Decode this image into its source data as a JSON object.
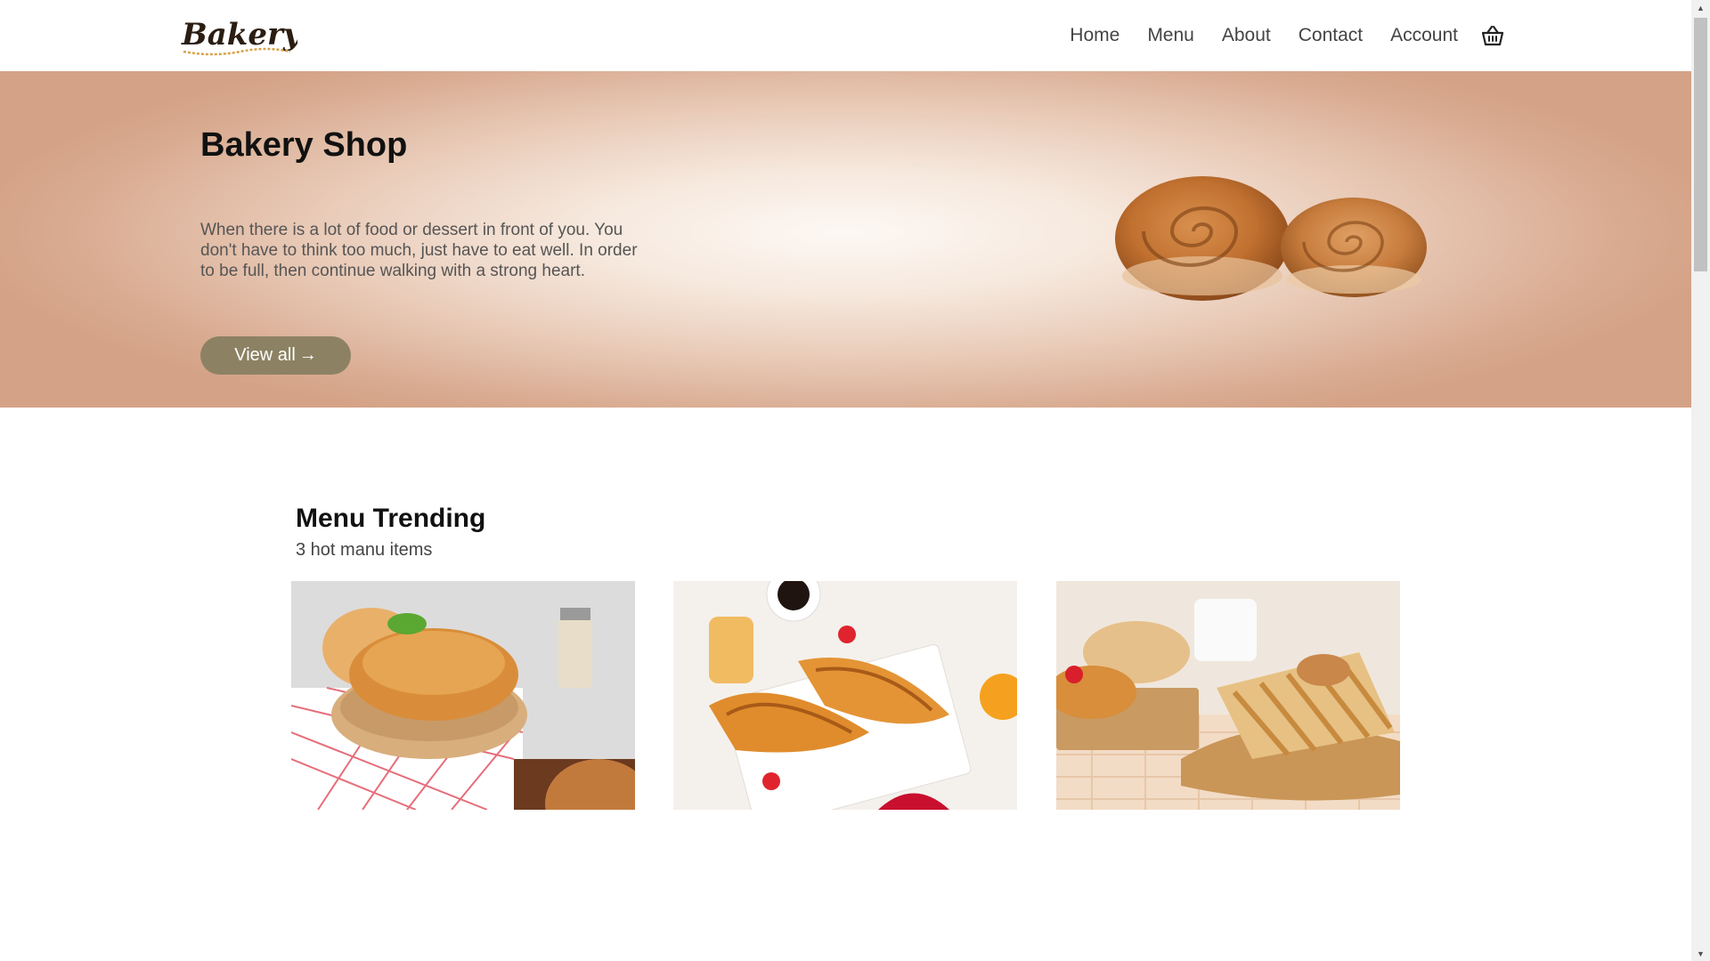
{
  "header": {
    "logo_text": "Bakery",
    "nav": [
      "Home",
      "Menu",
      "About",
      "Contact",
      "Account"
    ],
    "cart_icon": "basket-icon"
  },
  "hero": {
    "title": "Bakery Shop",
    "text": "When there is a lot of food or dessert in front of you. You don't have to think too much, just have to eat well. In order to be full, then continue walking with a strong heart.",
    "button_label": "View all",
    "button_icon": "arrow-right-icon",
    "image": "cinnamon-rolls-image"
  },
  "trending": {
    "title": "Menu Trending",
    "subtitle": "3 hot manu items",
    "items": [
      {
        "image": "bread-loaf-image"
      },
      {
        "image": "croissants-image"
      },
      {
        "image": "pastries-image"
      }
    ]
  },
  "colors": {
    "button": "#8c8263",
    "hero_edge": "#d4a287",
    "hero_center": "#fdf8f4"
  }
}
